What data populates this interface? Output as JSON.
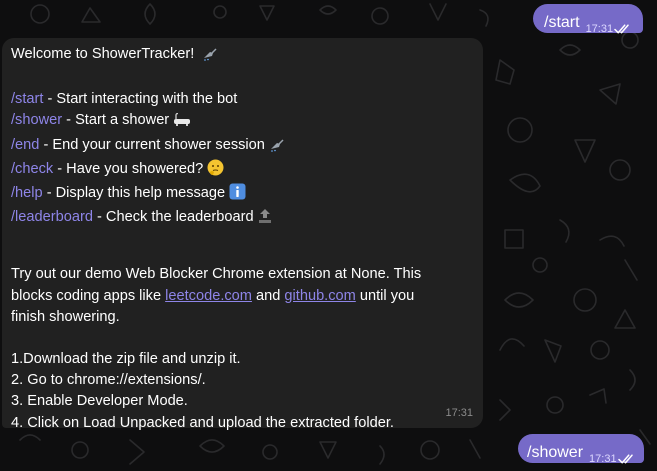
{
  "chat": {
    "outgoing": [
      {
        "text": "/start",
        "time": "17:31",
        "status_icon": "double-check-icon"
      },
      {
        "text": "/shower",
        "time": "17:31",
        "status_icon": "double-check-icon"
      }
    ],
    "bot_message": {
      "title": "Welcome to ShowerTracker!",
      "title_emoji": "shower-head-icon",
      "commands": [
        {
          "command": "/start",
          "description": " - Start interacting with the bot",
          "emoji": ""
        },
        {
          "command": "/shower",
          "description": " - Start a shower",
          "emoji": "bathtub-icon"
        },
        {
          "command": "/end",
          "description": " - End your current shower session",
          "emoji": "shower-head-icon"
        },
        {
          "command": "/check",
          "description": " - Have you showered?",
          "emoji": "thinking-face-icon"
        },
        {
          "command": "/help",
          "description": " - Display this help message",
          "emoji": "information-icon"
        },
        {
          "command": "/leaderboard",
          "description": " - Check the leaderboard",
          "emoji": "top-arrow-icon"
        }
      ],
      "promo": {
        "line1": "Try out our demo Web Blocker Chrome extension at None. This",
        "line2_prefix": "blocks coding apps like ",
        "link1": "leetcode.com",
        "line2_middle": " and ",
        "link2": "github.com",
        "line2_suffix": " until you",
        "line3": "finish showering."
      },
      "steps": [
        "1.Download the zip file and unzip it.",
        "2. Go to chrome://extensions/.",
        "3. Enable Developer Mode.",
        "4. Click on Load Unpacked and upload the extracted folder."
      ],
      "time": "17:31"
    }
  },
  "colors": {
    "background": "#0e0e0f",
    "outgoing_bubble": "#766ac8",
    "incoming_bubble": "#212121",
    "link": "#8e85e8"
  }
}
